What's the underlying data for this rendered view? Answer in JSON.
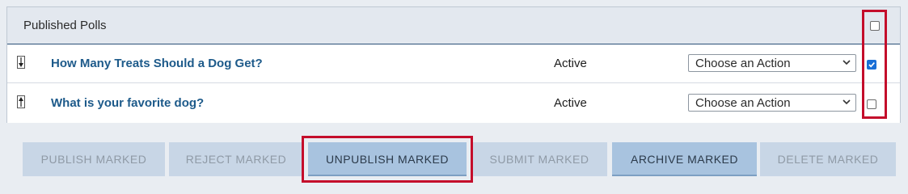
{
  "panel": {
    "title": "Published Polls",
    "header_checked": false
  },
  "rows": [
    {
      "sort_icon": "arrow-down-icon",
      "title": "How Many Treats Should a Dog Get?",
      "status": "Active",
      "action": "Choose an Action",
      "checked": true
    },
    {
      "sort_icon": "arrow-up-icon",
      "title": "What is your favorite dog?",
      "status": "Active",
      "action": "Choose an Action",
      "checked": false
    }
  ],
  "buttons": {
    "publish": "PUBLISH MARKED",
    "reject": "REJECT MARKED",
    "unpublish": "UNPUBLISH MARKED",
    "submit": "SUBMIT MARKED",
    "archive": "ARCHIVE MARKED",
    "delete": "DELETE MARKED"
  },
  "colors": {
    "highlight": "#c40d2b",
    "link": "#1d5a8a",
    "checkbox_checked": "#1a6fd6"
  }
}
